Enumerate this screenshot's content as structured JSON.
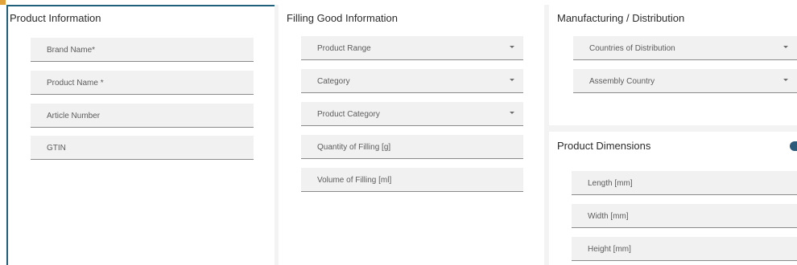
{
  "sections": {
    "product_information": {
      "title": "Product Information",
      "fields": [
        "Brand Name*",
        "Product Name *",
        "Article Number",
        "GTIN"
      ]
    },
    "filling_good_information": {
      "title": "Filling Good Information",
      "dropdowns": [
        "Product Range",
        "Category",
        "Product Category"
      ],
      "fields": [
        "Quantity of Filling [g]",
        "Volume of Filling [ml]"
      ]
    },
    "manufacturing_distribution": {
      "title": "Manufacturing / Distribution",
      "dropdowns": [
        "Countries of Distribution",
        "Assembly Country"
      ]
    },
    "product_dimensions": {
      "title": "Product Dimensions",
      "fields": [
        "Length [mm]",
        "Width [mm]",
        "Height [mm]"
      ]
    }
  },
  "icons": {
    "dropdown": "chevron-down-icon",
    "info": "info-icon"
  },
  "colors": {
    "panel_border": "#1f5f7a",
    "field_background": "#f1f1f1",
    "field_underline": "#8a8a8a",
    "accent": "#e2a23b",
    "info_dot": "#2b5a7a"
  }
}
